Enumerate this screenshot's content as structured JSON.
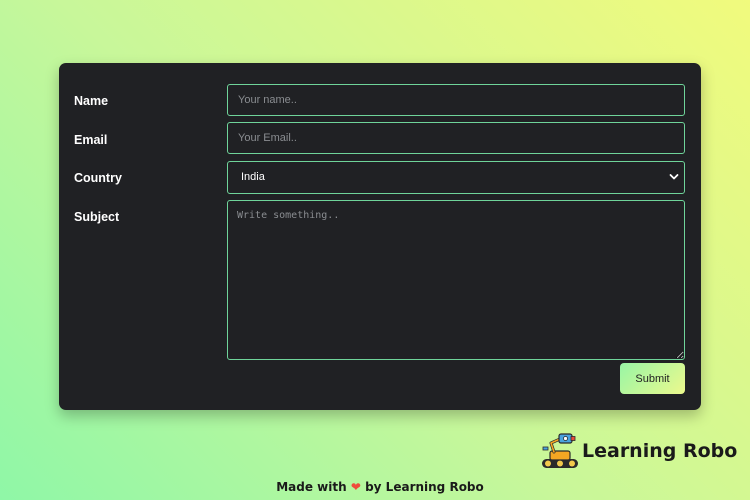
{
  "form": {
    "name_label": "Name",
    "name_placeholder": "Your name..",
    "email_label": "Email",
    "email_placeholder": "Your Email..",
    "country_label": "Country",
    "country_value": "India",
    "subject_label": "Subject",
    "subject_placeholder": "Write something..",
    "submit_label": "Submit"
  },
  "brand": {
    "name": "Learning Robo",
    "logo_icon": "robot-icon"
  },
  "footer": {
    "made_with": "Made with",
    "heart_icon": "heart-icon",
    "by": "by Learning Robo"
  },
  "colors": {
    "card_bg": "#202124",
    "field_border": "#6fd49a",
    "heart": "#ef4b3b",
    "gradient_start": "#8ff7a7",
    "gradient_end": "#f1fa7d"
  }
}
